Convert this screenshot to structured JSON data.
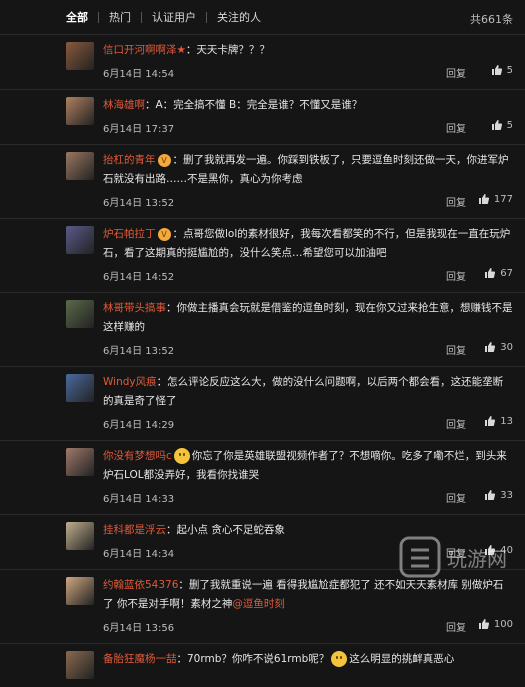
{
  "tabs": [
    {
      "label": "全部"
    },
    {
      "label": "热门"
    },
    {
      "label": "认证用户"
    },
    {
      "label": "关注的人"
    }
  ],
  "count": "共661条",
  "reply_label": "回复",
  "comments": [
    {
      "user": "信口开河啊啊泽",
      "user_suffix": "★",
      "text": "：天天卡牌？？？",
      "date": "6月14日 14:54",
      "likes": "5",
      "avatar_color": "#8a5a3c"
    },
    {
      "user": "林海雄啊",
      "text": "：A：完全搞不懂 B：完全是谁？不懂又是谁？",
      "date": "6月14日 17:37",
      "likes": "5",
      "avatar_color": "#b08060"
    },
    {
      "user": "抬杠的青年",
      "badge": "V",
      "text": "：删了我就再发一遍。你踩到铁板了，只要逗鱼时刻还做一天，你进军炉石就没有出路……不是黑你，真心为你考虑",
      "date": "6月14日 13:52",
      "likes": "177",
      "avatar_color": "#9a7860"
    },
    {
      "user": "炉石帕拉丁",
      "badge": "V",
      "text": "：点哥您做lol的素材很好，我每次看都笑的不行，但是我现在一直在玩炉石，看了这期真的挺尴尬的，没什么笑点…希望您可以加油吧",
      "date": "6月14日 14:52",
      "likes": "67",
      "avatar_color": "#5a5a8a"
    },
    {
      "user": "林哥带头搞事",
      "text": "：你做主播真会玩就是借鉴的逗鱼时刻，现在你又过来抢生意，想赚钱不是这样赚的",
      "date": "6月14日 13:52",
      "likes": "30",
      "avatar_color": "#5a6a4a"
    },
    {
      "user": "Windy风痕",
      "text": "：怎么评论反应这么大，做的没什么问题啊，以后两个都会看，这还能垄断的真是奇了怪了",
      "date": "6月14日 14:29",
      "likes": "13",
      "avatar_color": "#4a6aa0"
    },
    {
      "user": "你没有梦想吗c",
      "has_emoji": true,
      "text": "你忘了你是英雄联盟视频作者了？不想嘀你。吃多了嘞不烂，到头来炉石LOL都没弄好，我看你找谁哭",
      "date": "6月14日 14:33",
      "likes": "33",
      "avatar_color": "#a07a6a"
    },
    {
      "user": "挂科都是浮云",
      "text": "：起小点 贪心不足蛇吞象",
      "date": "6月14日 14:34",
      "likes": "40",
      "avatar_color": "#c0b090"
    },
    {
      "user": "约翰蓝依54376",
      "text": "：删了我就重说一遍 看得我尴尬症都犯了 还不如天天素材库 别做炉石了 你不是对手啊！素材之神",
      "mention": "@逗鱼时刻",
      "date": "6月14日 13:56",
      "likes": "100",
      "avatar_color": "#d0a880"
    },
    {
      "user": "备胎狂魔杨一喆",
      "text": "：70rmb？你咋不说61rmb呢？",
      "tail": "这么明显的挑衅真恶心",
      "has_emoji2": true,
      "date": "",
      "likes": "",
      "avatar_color": "#8a6a50"
    }
  ],
  "watermark": "玩游网"
}
